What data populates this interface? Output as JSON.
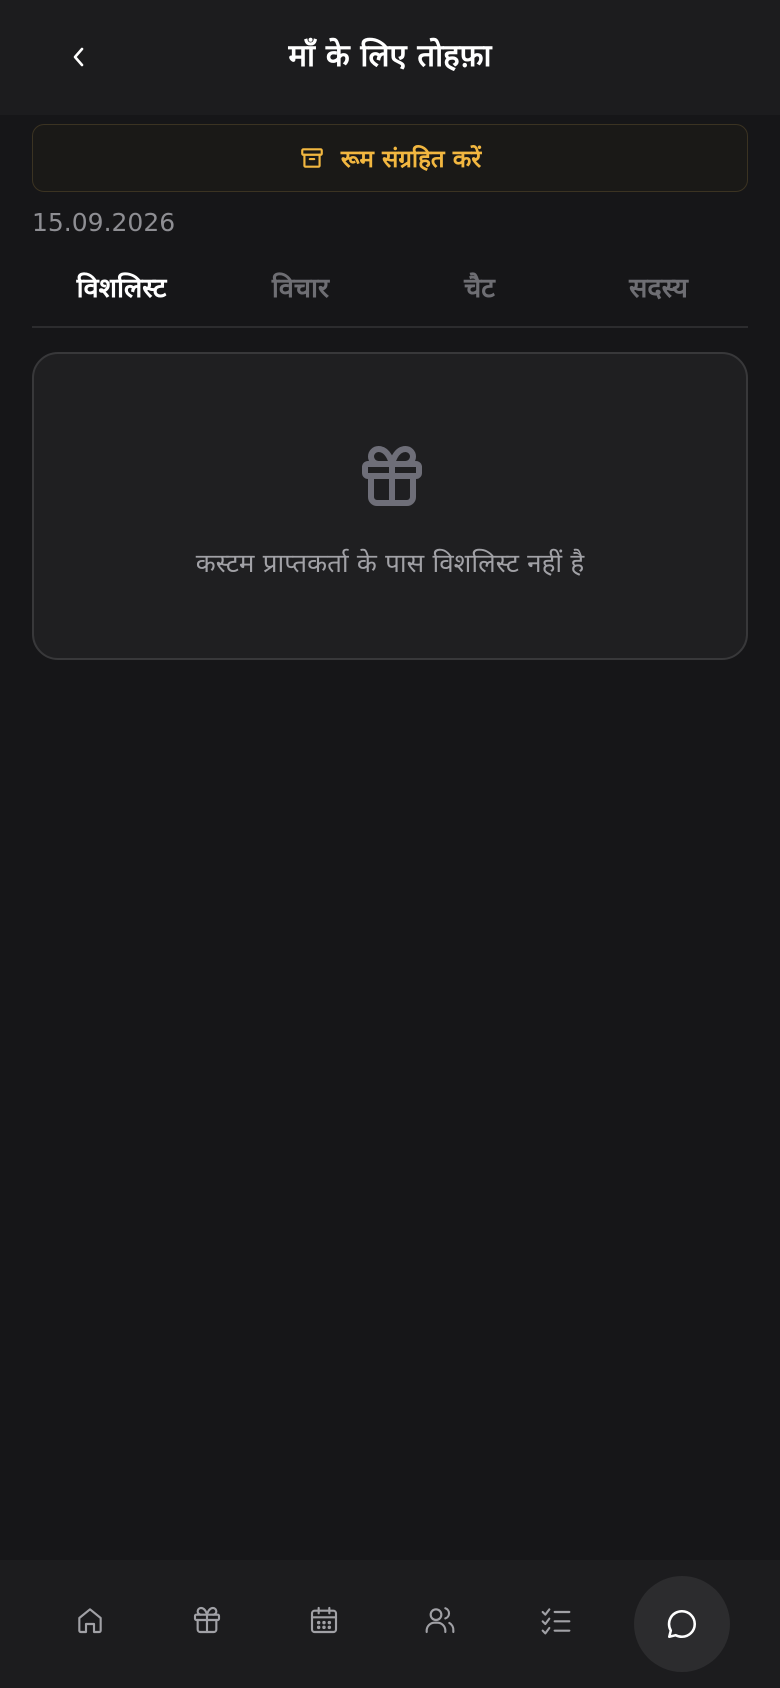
{
  "header": {
    "title": "माँ के लिए तोहफ़ा",
    "back_icon": "chevron-left-icon"
  },
  "archive_button": {
    "label": "रूम संग्रहित करें",
    "icon": "archive-icon",
    "accent_color": "#f2b740"
  },
  "date": "15.09.2026",
  "tabs": [
    {
      "label": "विशलिस्ट",
      "active": true
    },
    {
      "label": "विचार",
      "active": false
    },
    {
      "label": "चैट",
      "active": false
    },
    {
      "label": "सदस्य",
      "active": false
    }
  ],
  "empty_state": {
    "icon": "gift-icon",
    "message": "कस्टम प्राप्तकर्ता के पास विशलिस्ट नहीं है"
  },
  "bottom_nav": {
    "items": [
      {
        "icon": "home-icon"
      },
      {
        "icon": "gift-icon"
      },
      {
        "icon": "calendar-icon"
      },
      {
        "icon": "users-icon"
      },
      {
        "icon": "checklist-icon"
      },
      {
        "icon": "chat-icon",
        "active": true
      }
    ]
  }
}
